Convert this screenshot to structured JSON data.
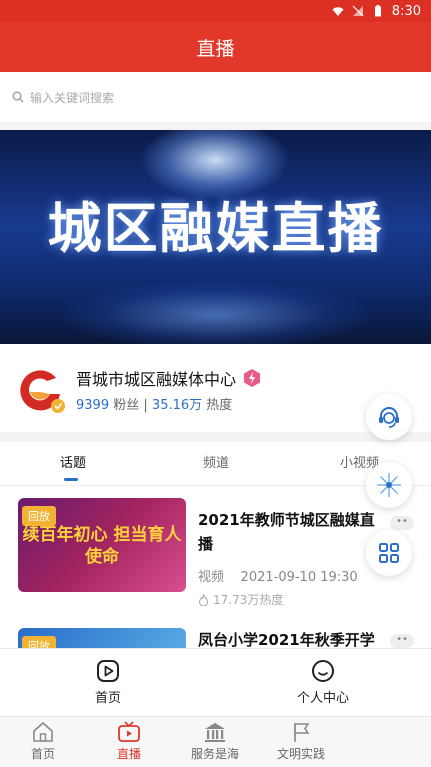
{
  "status": {
    "time": "8:30"
  },
  "header": {
    "title": "直播"
  },
  "search": {
    "placeholder": "输入关键词搜索"
  },
  "banner": {
    "title": "城区融媒直播"
  },
  "profile": {
    "name": "晋城市城区融媒体中心",
    "fans_count": "9399",
    "fans_label": "粉丝",
    "separator": "|",
    "heat_count": "35.16万",
    "heat_label": "热度"
  },
  "tabs": [
    {
      "label": "话题",
      "active": true
    },
    {
      "label": "频道",
      "active": false
    },
    {
      "label": "小视频",
      "active": false
    }
  ],
  "items": [
    {
      "badge": "回放",
      "thumb_text": "续百年初心 担当育人使命",
      "title": "2021年教师节城区融媒直播",
      "category": "视频",
      "datetime": "2021-09-10 19:30",
      "heat": "17.73万热度",
      "more": "••"
    },
    {
      "badge": "回放",
      "title": "凤台小学2021年秋季开学",
      "more": "••"
    }
  ],
  "subnav": [
    {
      "label": "首页",
      "icon": "play-square-icon"
    },
    {
      "label": "个人中心",
      "icon": "smile-icon"
    }
  ],
  "bottomnav": [
    {
      "label": "首页",
      "icon": "home-icon",
      "active": false
    },
    {
      "label": "直播",
      "icon": "tv-icon",
      "active": true
    },
    {
      "label": "服务是海",
      "icon": "bank-icon",
      "active": false
    },
    {
      "label": "文明实践",
      "icon": "flag-icon",
      "active": false
    }
  ],
  "colors": {
    "brand_red": "#e2382b",
    "accent_blue": "#2a6fc9",
    "badge_orange": "#f2b233"
  }
}
